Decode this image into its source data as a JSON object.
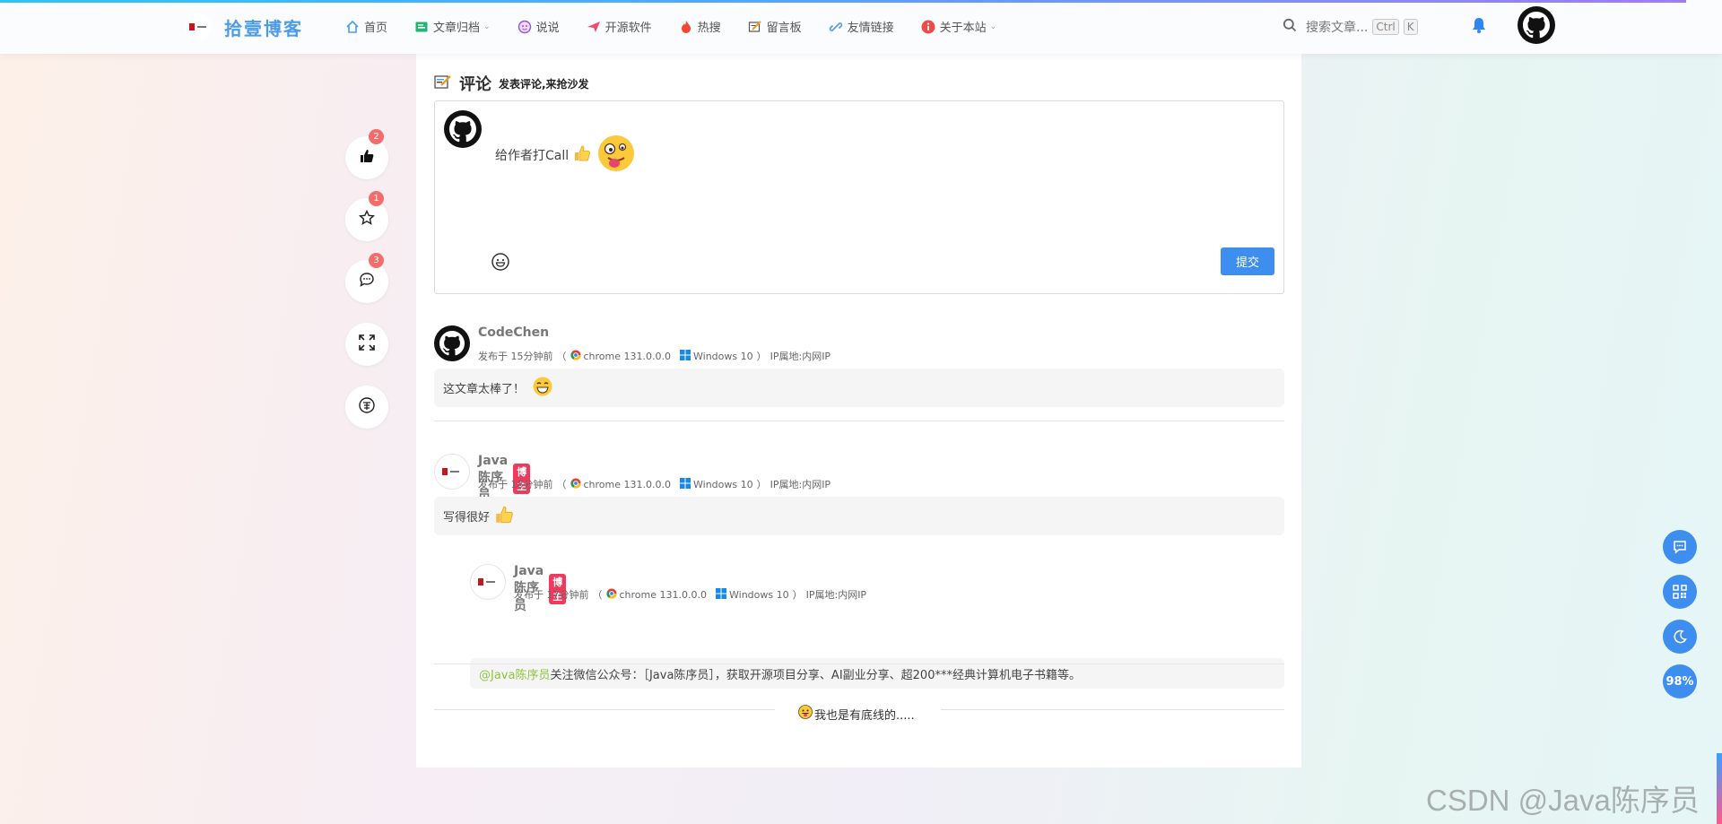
{
  "header": {
    "site_name": "拾壹博客",
    "nav": [
      {
        "label": "首页",
        "icon": "home-icon",
        "has_dropdown": false
      },
      {
        "label": "文章归档",
        "icon": "archive-icon",
        "has_dropdown": true
      },
      {
        "label": "说说",
        "icon": "chat-face-icon",
        "has_dropdown": false
      },
      {
        "label": "开源软件",
        "icon": "paper-plane-icon",
        "has_dropdown": false
      },
      {
        "label": "热搜",
        "icon": "fire-icon",
        "has_dropdown": false
      },
      {
        "label": "留言板",
        "icon": "message-board-icon",
        "has_dropdown": false
      },
      {
        "label": "友情链接",
        "icon": "link-icon",
        "has_dropdown": false
      },
      {
        "label": "关于本站",
        "icon": "info-icon",
        "has_dropdown": true
      }
    ],
    "search_placeholder": "搜索文章...",
    "shortcut_ctrl": "Ctrl",
    "shortcut_key": "K"
  },
  "side_actions": [
    {
      "name": "like",
      "icon": "thumbs-up-icon",
      "badge": "2"
    },
    {
      "name": "favorite",
      "icon": "star-icon",
      "badge": "1"
    },
    {
      "name": "comment",
      "icon": "comment-icon",
      "badge": "3"
    },
    {
      "name": "fullscreen",
      "icon": "expand-icon",
      "badge": ""
    },
    {
      "name": "reward",
      "icon": "reward-icon",
      "badge": ""
    }
  ],
  "comments_section": {
    "title": "评论",
    "subtitle": "发表评论,来抢沙发",
    "editor_text": "给作者打Call",
    "submit_label": "提交"
  },
  "comments": [
    {
      "author": "CodeChen",
      "is_author": false,
      "time": "发布于 15分钟前",
      "browser": "chrome 131.0.0.0",
      "os": "Windows 10",
      "ip": "IP属地:内网IP",
      "content": "这文章太棒了！"
    },
    {
      "author": "Java陈序员",
      "is_author": true,
      "time": "发布于 18分钟前",
      "browser": "chrome 131.0.0.0",
      "os": "Windows 10",
      "ip": "IP属地:内网IP",
      "content": "写得很好"
    }
  ],
  "reply": {
    "author": "Java陈序员",
    "is_author": true,
    "time": "发布于 17分钟前",
    "browser": "chrome 131.0.0.0",
    "os": "Windows 10",
    "ip": "IP属地:内网IP",
    "mention": "@Java陈序员",
    "content": "关注微信公众号：［Java陈序员］，获取开源项目分享、AI副业分享、超200***经典计算机电子书籍等。"
  },
  "author_tag": "博主",
  "paren_open": "（",
  "paren_close": "）",
  "footer_text": "我也是有底线的.....",
  "floating": {
    "progress": "98%"
  },
  "watermark": "CSDN @Java陈序员",
  "colors": {
    "accent": "#3e8ef0",
    "brand_text": "#4c9be8",
    "tag": "#ef3a5d",
    "badge": "#f56c6c",
    "mention": "#8ec53c"
  }
}
